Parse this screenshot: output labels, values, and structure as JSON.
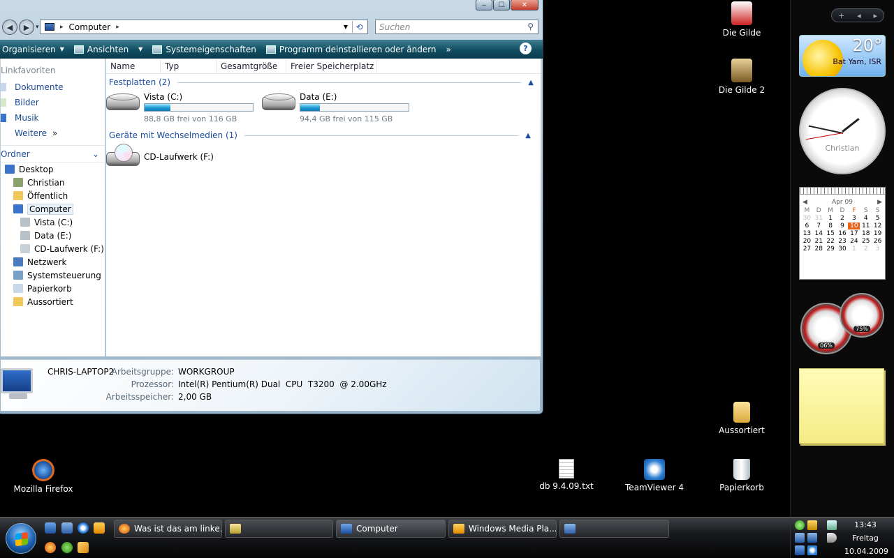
{
  "window": {
    "address": "Computer",
    "search_placeholder": "Suchen",
    "caption": {
      "minimize": "‒",
      "maximize": "☐",
      "close": "✕"
    }
  },
  "commands": {
    "organize": "Organisieren",
    "views": "Ansichten",
    "system_properties": "Systemeigenschaften",
    "uninstall": "Programm deinstallieren oder ändern",
    "more": "»",
    "help": "?"
  },
  "nav": {
    "favorites_header": "Linkfavoriten",
    "favorites": [
      {
        "label": "Dokumente",
        "icon": "documents-icon"
      },
      {
        "label": "Bilder",
        "icon": "pictures-icon"
      },
      {
        "label": "Musik",
        "icon": "music-icon"
      }
    ],
    "more_label": "Weitere",
    "more_arrow": "»",
    "folders_label": "Ordner",
    "folders_chevron": "⌄",
    "tree": [
      {
        "label": "Desktop",
        "icon": "desktop-icon"
      },
      {
        "label": "Christian",
        "icon": "user-folder-icon"
      },
      {
        "label": "Öffentlich",
        "icon": "folder-icon"
      },
      {
        "label": "Computer",
        "icon": "computer-icon"
      },
      {
        "label": "Vista (C:)",
        "icon": "drive-icon"
      },
      {
        "label": "Data (E:)",
        "icon": "drive-icon"
      },
      {
        "label": "CD-Laufwerk (F:)",
        "icon": "cd-drive-icon"
      },
      {
        "label": "Netzwerk",
        "icon": "network-icon"
      },
      {
        "label": "Systemsteuerung",
        "icon": "control-panel-icon"
      },
      {
        "label": "Papierkorb",
        "icon": "recycle-bin-icon"
      },
      {
        "label": "Aussortiert",
        "icon": "folder-icon"
      }
    ]
  },
  "columns": [
    "Name",
    "Typ",
    "Gesamtgröße",
    "Freier Speicherplatz"
  ],
  "groups": {
    "hard_drives": "Festplatten (2)",
    "removable": "Geräte mit Wechselmedien (1)"
  },
  "drives": [
    {
      "name": "Vista (C:)",
      "free_text": "88,8 GB frei von 116 GB",
      "used_fraction": 0.24
    },
    {
      "name": "Data (E:)",
      "free_text": "94,4 GB frei von 115 GB",
      "used_fraction": 0.18
    }
  ],
  "cd_drive": {
    "name": "CD-Laufwerk (F:)"
  },
  "details": {
    "computer_name": "CHRIS-LAPTOP2",
    "workgroup_label": "Arbeitsgruppe:",
    "workgroup": "WORKGROUP",
    "cpu_label": "Prozessor:",
    "cpu": "Intel(R) Pentium(R) Dual  CPU  T3200  @ 2.00GHz",
    "ram_label": "Arbeitsspeicher:",
    "ram": "2,00 GB"
  },
  "sidebar": {
    "controls": {
      "add": "+",
      "prev": "◂",
      "next": "▸"
    },
    "weather": {
      "temp": "20°",
      "city": "Bat Yam, ISR"
    },
    "clock": {
      "name": "Christian"
    },
    "calendar": {
      "month": "Apr 09",
      "prev": "◀",
      "next": "▶",
      "dow": [
        "M",
        "D",
        "M",
        "D",
        "F",
        "S",
        "S"
      ],
      "days": [
        "30",
        "31",
        "1",
        "2",
        "3",
        "4",
        "5",
        "6",
        "7",
        "8",
        "9",
        "10",
        "11",
        "12",
        "13",
        "14",
        "15",
        "16",
        "17",
        "18",
        "19",
        "20",
        "21",
        "22",
        "23",
        "24",
        "25",
        "26",
        "27",
        "28",
        "29",
        "30",
        "1",
        "2",
        "3"
      ]
    },
    "cpu_meter": "06%",
    "mem_meter": "75%"
  },
  "desktop_icons": [
    {
      "label": "Die Gilde"
    },
    {
      "label": "Die Gilde 2"
    },
    {
      "label": "Aussortiert"
    },
    {
      "label": "Mozilla Firefox"
    },
    {
      "label": "db 9.4.09.txt"
    },
    {
      "label": "TeamViewer 4"
    },
    {
      "label": "Papierkorb"
    }
  ],
  "taskbar": {
    "buttons": [
      "Was ist das am linke...",
      "",
      "Computer",
      "Windows Media Pla...",
      ""
    ],
    "time": "13:43",
    "day": "Freitag",
    "date": "10.04.2009"
  },
  "colors": {
    "accent": "#1c4b94",
    "cmdbar": "#124f63",
    "today": "#e8621c",
    "bar_fill": "#26a0d8"
  }
}
